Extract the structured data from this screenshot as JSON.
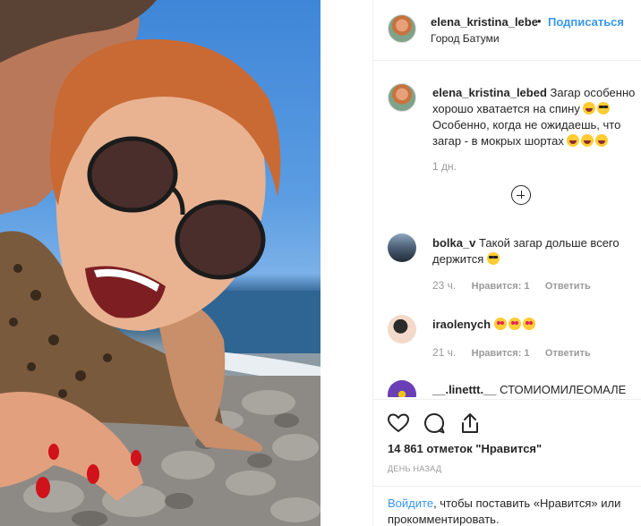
{
  "post": {
    "username": "elena_kristina_lebe",
    "follow_label": "Подписаться",
    "separator": "•",
    "location": "Город Батуми"
  },
  "comments": [
    {
      "username": "elena_kristina_lebed",
      "text_1": " Загар особенно хорошо хватается на спину",
      "text_2": "Особенно, когда не ожидаешь, что загар - в мокрых шортах ",
      "time": "1 дн."
    },
    {
      "username": "bolka_v",
      "text": " Такой загар дольше всего держится ",
      "time": "23 ч.",
      "likes": "Нравится: 1",
      "reply": "Ответить"
    },
    {
      "username": "iraolenych",
      "text": " ",
      "time": "21 ч.",
      "likes": "Нравится: 1",
      "reply": "Ответить"
    },
    {
      "username": "__.linettt.__",
      "text": " СТОМИОМИЛЕОМАЛЕ"
    }
  ],
  "actions": {
    "likes_count": "14 861 отметок \"Нравится\"",
    "date": "ДЕНЬ НАЗАД"
  },
  "login": {
    "link": "Войдите",
    "text": ", чтобы поставить «Нравится» или прокомментировать."
  },
  "icons": [
    "heart-icon",
    "comment-icon",
    "share-icon",
    "add-comment-icon"
  ],
  "colors": {
    "link": "#3897f0",
    "muted": "#999999",
    "border": "#efefef"
  }
}
